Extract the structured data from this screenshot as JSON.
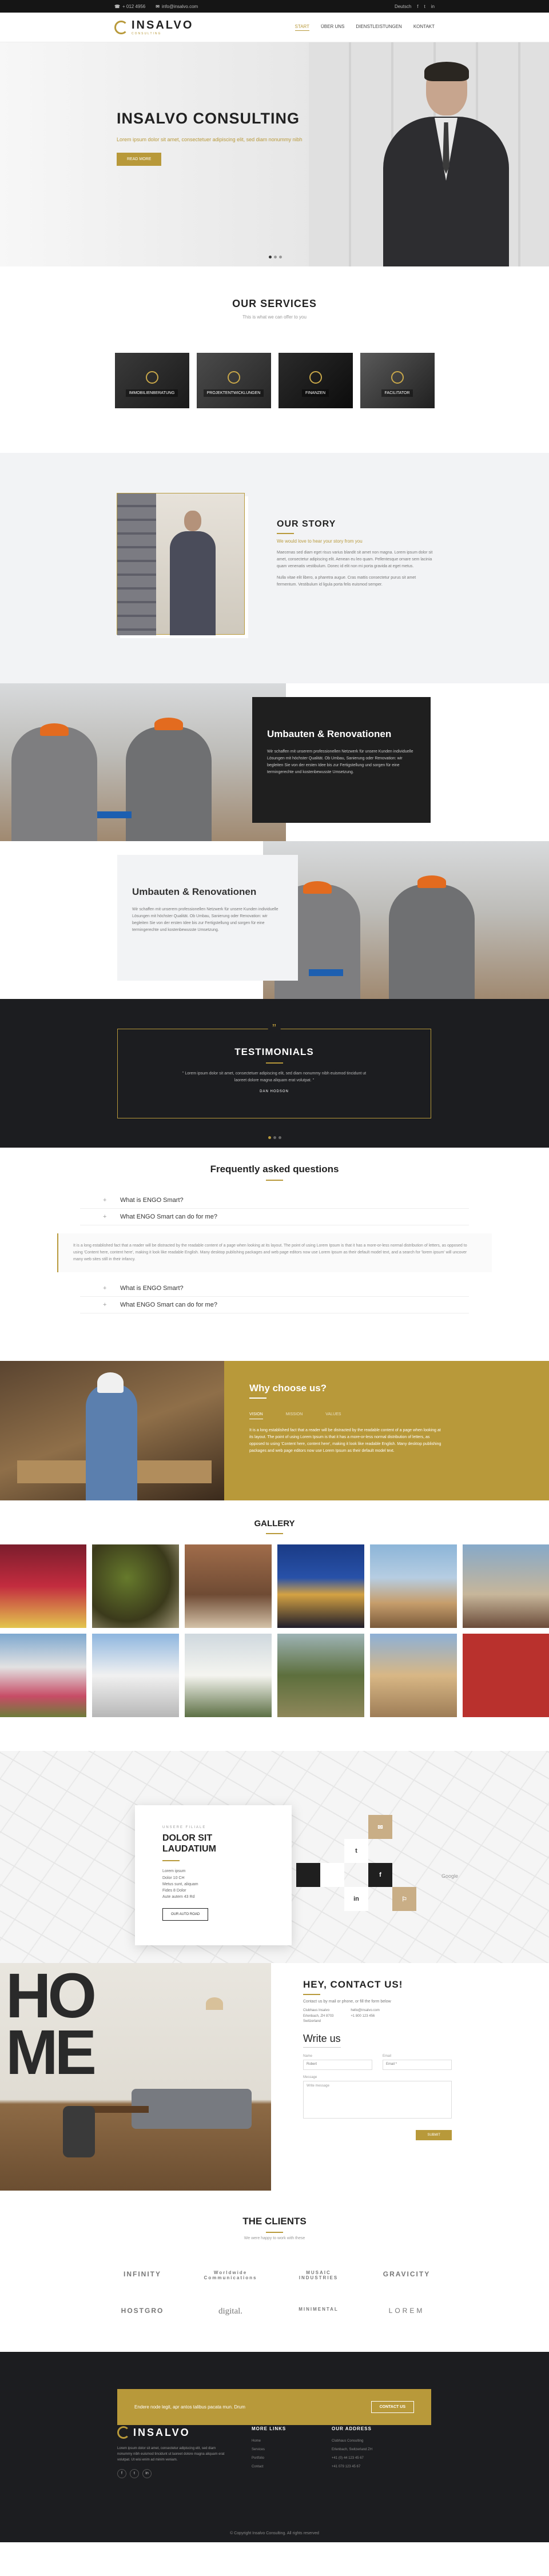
{
  "topbar": {
    "phone": "+ 012 4956",
    "email": "info@insalvo.com",
    "lang": "Deutsch",
    "social": [
      "f",
      "t",
      "in"
    ]
  },
  "header": {
    "logo": "INSALVO",
    "logo_sub": "CONSULTING",
    "nav": [
      "Start",
      "Über uns",
      "Dienstleistungen",
      "Kontakt"
    ]
  },
  "hero": {
    "title": "INSALVO CONSULTING",
    "text": "Lorem ipsum dolor sit amet, consectetuer adipiscing elit, sed diam nonummy nibh",
    "button": "Read more"
  },
  "services": {
    "title": "OUR SERVICES",
    "subtitle": "This is what we can offer to you",
    "items": [
      "Immobilienberatung",
      "Projektentwicklungen",
      "Finanzen",
      "Facilitator"
    ]
  },
  "story": {
    "title": "OUR STORY",
    "lead": "We would love to hear your story from you",
    "p1": "Maecenas sed diam eget risus varius blandit sit amet non magna. Lorem ipsum dolor sit amet, consectetur adipiscing elit. Aenean eu leo quam. Pellentesque ornare sem lacinia quam venenatis vestibulum. Donec id elit non mi porta gravida at eget metus.",
    "p2": "Nulla vitae elit libero, a pharetra augue. Cras mattis consectetur purus sit amet fermentum. Vestibulum id ligula porta felis euismod semper."
  },
  "renov1": {
    "title": "Umbauten & Renovationen",
    "text": "Wir schaffen mit unserem professionellen Netzwerk für unsere Kunden individuelle Lösungen mit höchster Qualität. Ob Umbau, Sanierung oder Renovation: wir begleiten Sie von der ersten Idee bis zur Fertigstellung und sorgen für eine termingerechte und kostenbewusste Umsetzung."
  },
  "renov2": {
    "title": "Umbauten & Renovationen",
    "text": "Wir schaffen mit unserem professionellen Netzwerk für unsere Kunden individuelle Lösungen mit höchster Qualität. Ob Umbau, Sanierung oder Renovation: wir begleiten Sie von der ersten Idee bis zur Fertigstellung und sorgen für eine termingerechte und kostenbewusste Umsetzung."
  },
  "testimonials": {
    "quote_mark": "”",
    "title": "TESTIMONIALS",
    "text": "\" Lorem ipsum dolor sit amet, consectetuer adipiscing elit, sed diam nonummy nibh euismod tincidunt ut laoreet dolore magna aliquam erat volutpat. \"",
    "author": "Dan Hodson"
  },
  "faq": {
    "title": "Frequently asked questions",
    "items_top": [
      "What is ENGO Smart?",
      "What ENGO Smart can do for me?"
    ],
    "open_text": "It is a long established fact that a reader will be distracted by the readable content of a page when looking at its layout. The point of using Lorem Ipsum is that it has a more-or-less normal distribution of letters, as opposed to using 'Content here, content here', making it look like readable English. Many desktop publishing packages and web page editors now use Lorem Ipsum as their default model text, and a search for 'lorem ipsum' will uncover many web sites still in their infancy.",
    "items_bottom": [
      "What is ENGO Smart?",
      "What ENGO Smart can do for me?"
    ]
  },
  "why": {
    "title": "Why choose us?",
    "tabs": [
      "Vision",
      "Mission",
      "Values"
    ],
    "text": "It is a long established fact that a reader will be distracted by the readable content of a page when looking at its layout. The point of using Lorem Ipsum is that it has a more-or-less normal distribution of letters, as opposed to using 'Content here, content here', making it look like readable English. Many desktop publishing packages and web page editors now use Lorem Ipsum as their default model text."
  },
  "gallery": {
    "title": "GALLERY"
  },
  "map": {
    "small": "Unsere Filiale",
    "title": "DOLOR SIT LAUDATIUM",
    "addr": [
      "Lorem ipsum",
      "Dolor 10 CH",
      "Metus sunt, aliquam",
      "Fides 8 Dolor",
      "Aute autem 43 Rd"
    ],
    "button": "Our Auto Road",
    "google": "Google",
    "tiles": [
      "✉",
      "t",
      "f",
      "in",
      "⚐"
    ]
  },
  "contact": {
    "title": "HEY, CONTACT US!",
    "sub": "Contact us by mail or phone, or fill the form below",
    "info_left": [
      "Clubhaus Insalvo",
      "Erlenbach, ZH 8703",
      "Switzerland"
    ],
    "info_right": [
      "hello@insalvo.com",
      "+1 800 123 456"
    ],
    "form_title": "Write us",
    "name_label": "Name",
    "name_value": "Robert",
    "email_label": "Email",
    "email_value": "Email *",
    "message_label": "Message",
    "message_placeholder": "Write message",
    "submit": "Submit"
  },
  "clients": {
    "title": "THE CLIENTS",
    "sub": "We were happy to work with these",
    "row1": [
      "INFINITY",
      "Worldwide Communications",
      "MUSAIC INDUSTRIES",
      "GRAVICITY"
    ],
    "row2": [
      "HOSTGRO",
      "digital.",
      "MINIMENTAL",
      "LOREM"
    ]
  },
  "cta": {
    "text": "Endere node legit, apr antos talibus pacata mun. Drum",
    "button": "Contact us"
  },
  "footer": {
    "logo": "INSALVO",
    "about": "Lorem ipsum dolor sit amet, consectetur adipiscing elit, sed diam nonummy nibh euismod tincidunt ut laoreet dolore magna aliquam erat volutpat. Ut wisi enim ad minim veniam.",
    "social": [
      "f",
      "t",
      "in"
    ],
    "links_title": "More links",
    "links": [
      "Home",
      "Services",
      "Portfolio",
      "Contact"
    ],
    "address_title": "Our Address",
    "address": [
      "Clubhaus Consulting",
      "Erlenbach, Switzerland ZH",
      "+41 (0) 44 123 45 67",
      "+41 079 123 45 67"
    ],
    "copy": "© Copyright Insalvo Consulting. All rights reserved"
  },
  "colors": {
    "accent": "#b8993a",
    "dark": "#1c1d20"
  }
}
